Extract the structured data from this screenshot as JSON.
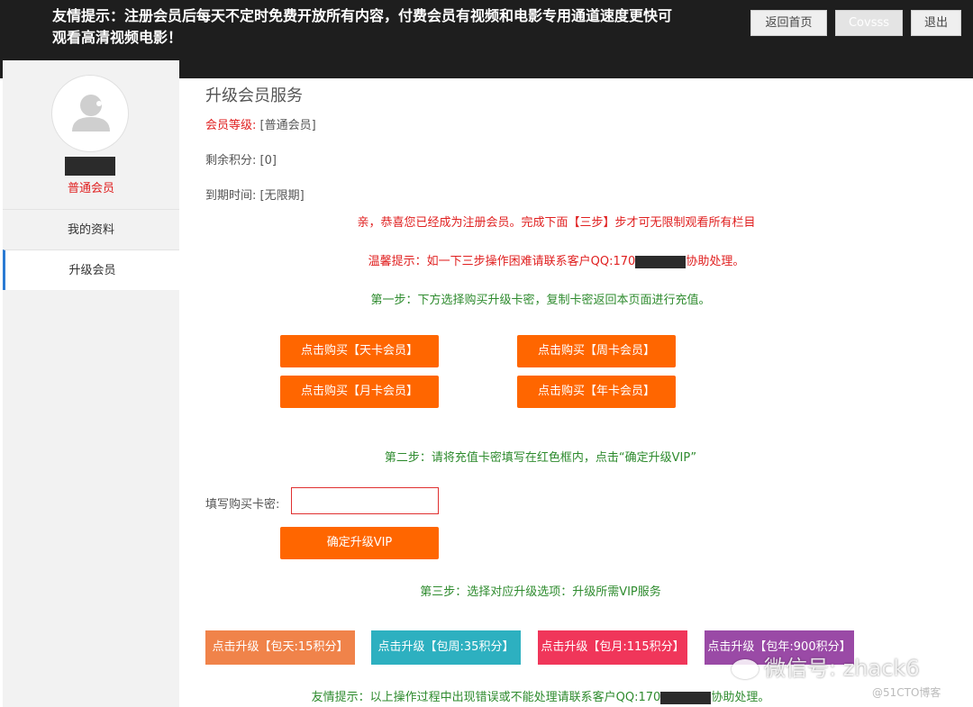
{
  "topbar": {
    "notice": "友情提示：注册会员后每天不定时免费开放所有内容，付费会员有视频和电影专用通道速度更快可观看高清视频电影！",
    "buttons": {
      "home": "返回首页",
      "user": "Covsss",
      "logout": "退出"
    }
  },
  "sidebar": {
    "level_label": "普通会员",
    "items": [
      {
        "label": "我的资料"
      },
      {
        "label": "升级会员"
      }
    ]
  },
  "main": {
    "title": "升级会员服务",
    "level_key": "会员等级:",
    "level_value": "[普通会员]",
    "points_key": "剩余积分:",
    "points_value": "[0]",
    "expire_key": "到期时间:",
    "expire_value": "[无限期]",
    "congrats": "亲，恭喜您已经成为注册会员。完成下面【三步】步才可无限制观看所有栏目",
    "tip_prefix": "温馨提示：如一下三步操作困难请联系客户QQ:170",
    "tip_suffix": "协助处理。",
    "step1": "第一步：下方选择购买升级卡密，复制卡密返回本页面进行充值。",
    "buy_buttons": {
      "day": "点击购买【天卡会员】",
      "week": "点击购买【周卡会员】",
      "month": "点击购买【月卡会员】",
      "year": "点击购买【年卡会员】"
    },
    "step2": "第二步：请将充值卡密填写在红色框内，点击“确定升级VIP”",
    "card_label": "填写购买卡密:",
    "card_value": "",
    "confirm_button": "确定升级VIP",
    "step3": "第三步：选择对应升级选项：升级所需VIP服务",
    "packages": {
      "day": "点击升级【包天:15积分】",
      "week": "点击升级【包周:35积分】",
      "month": "点击升级【包月:115积分】",
      "year": "点击升级【包年:900积分】"
    },
    "footer_prefix": "友情提示：以上操作过程中出现错误或不能处理请联系客户QQ:170",
    "footer_suffix": "协助处理。"
  },
  "watermark": {
    "text": "微信号: zhack6",
    "source": "@51CTO博客"
  },
  "colors": {
    "orange": "#ff6600",
    "pkg_day": "#f0834a",
    "pkg_week": "#2db0c0",
    "pkg_month": "#f0365a",
    "pkg_year": "#9a4aa6"
  }
}
